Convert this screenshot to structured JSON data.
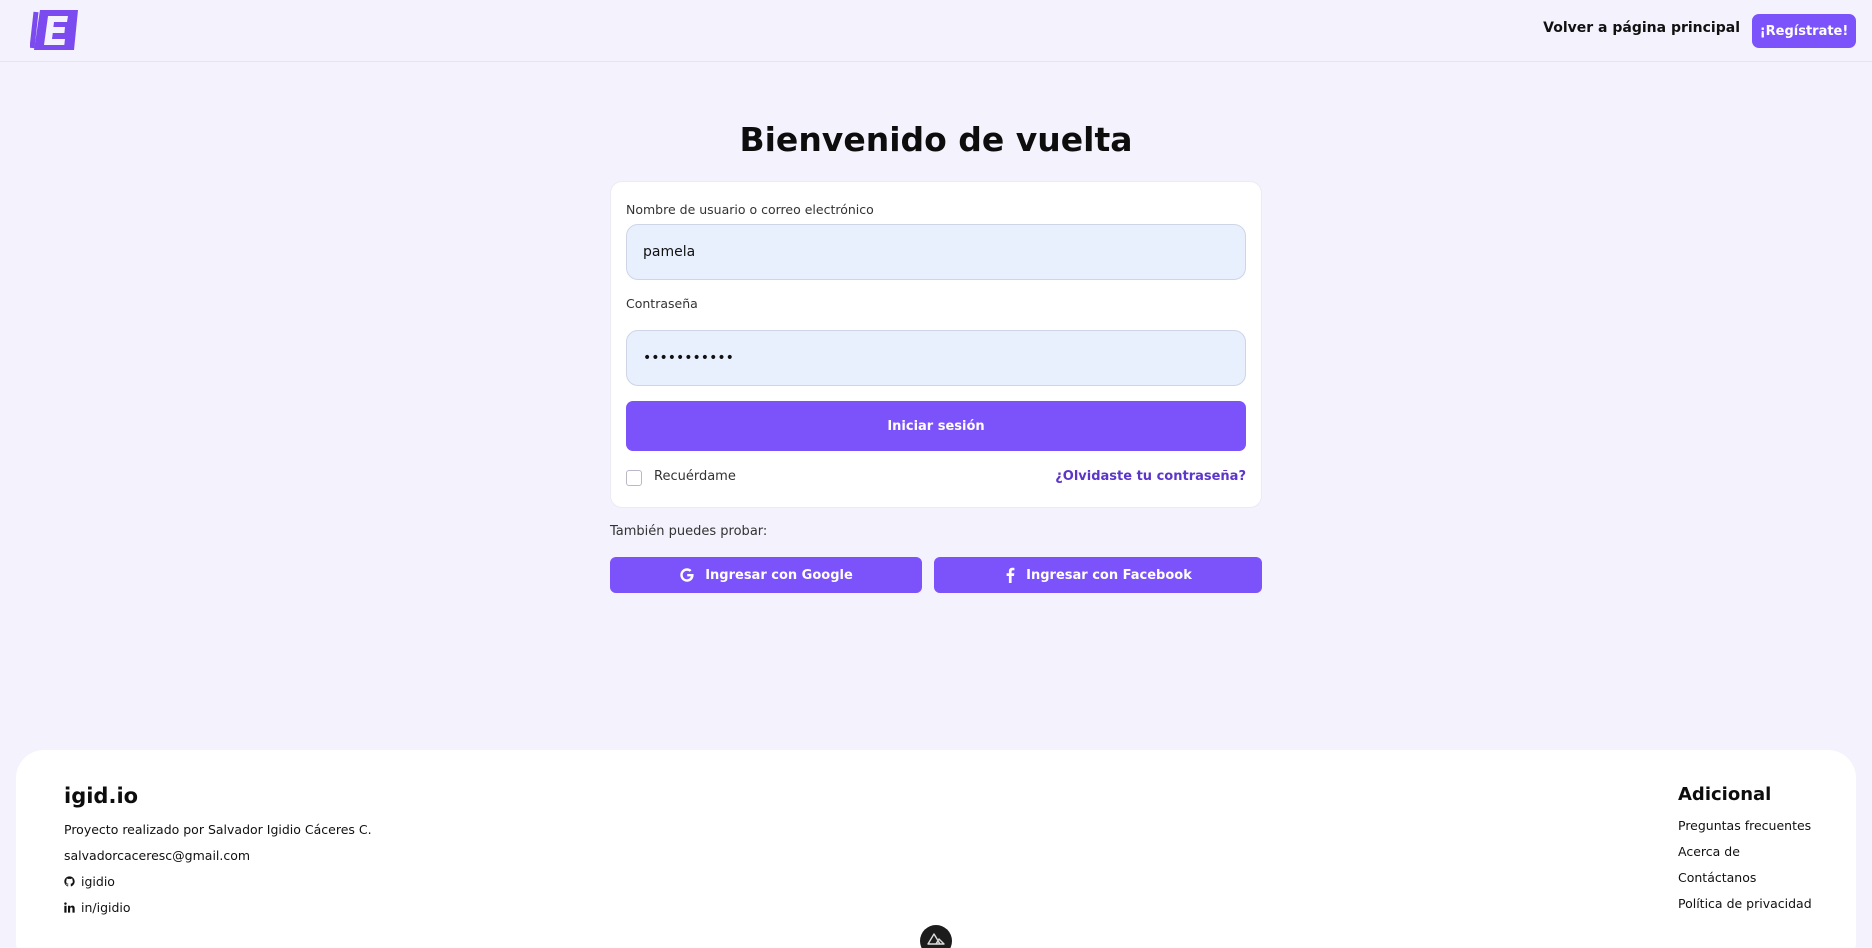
{
  "header": {
    "logo_icon": "logo-e-icon",
    "home_link": "Volver a página principal",
    "register_button": "¡Regístrate!"
  },
  "title": "Bienvenido de vuelta",
  "login_form": {
    "username_label": "Nombre de usuario o correo electrónico",
    "username_value": "pamela",
    "password_label": "Contraseña",
    "password_value": "•••••••••••",
    "submit_button": "Iniciar sesión",
    "remember_label": "Recuérdame",
    "remember_checked": false,
    "forgot_link": "¿Olvidaste tu contraseña?"
  },
  "social": {
    "label": "También puedes probar:",
    "google_button": "Ingresar con Google",
    "facebook_button": "Ingresar con Facebook"
  },
  "footer": {
    "brand": "igid.io",
    "description": "Proyecto realizado por Salvador Igidio Cáceres C.",
    "email": "salvadorcaceresc@gmail.com",
    "github": "igidio",
    "linkedin": "in/igidio",
    "additional_title": "Adicional",
    "links": [
      "Preguntas frecuentes",
      "Acerca de",
      "Contáctanos",
      "Política de privacidad"
    ]
  },
  "colors": {
    "accent": "#7c52fb",
    "background": "#f3f2fd",
    "input_bg": "#e8effd",
    "link": "#5b36c9"
  }
}
